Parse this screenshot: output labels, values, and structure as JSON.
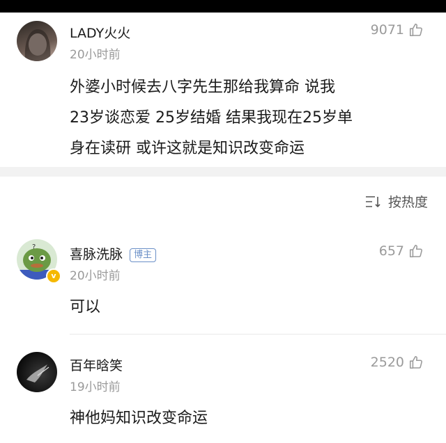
{
  "comment1": {
    "username": "LADY火火",
    "time": "20小时前",
    "likes": "9071",
    "text_lines": [
      "外婆小时候去八字先生那给我算命 说我",
      "23岁谈恋爱 25岁结婚 结果我现在25岁单",
      "身在读研  或许这就是知识改变命运"
    ]
  },
  "sort": {
    "label": "按热度",
    "icon": "sort-icon"
  },
  "reply1": {
    "username": "喜脉洗脉",
    "badge": "博主",
    "time": "20小时前",
    "likes": "657",
    "text": "可以"
  },
  "reply2": {
    "username": "百年晗笑",
    "time": "19小时前",
    "likes": "2520",
    "text": "神他妈知识改变命运"
  },
  "colors": {
    "topbar": "#000000",
    "gap": "#f2f2f2",
    "badge": "#6a8fc7"
  }
}
